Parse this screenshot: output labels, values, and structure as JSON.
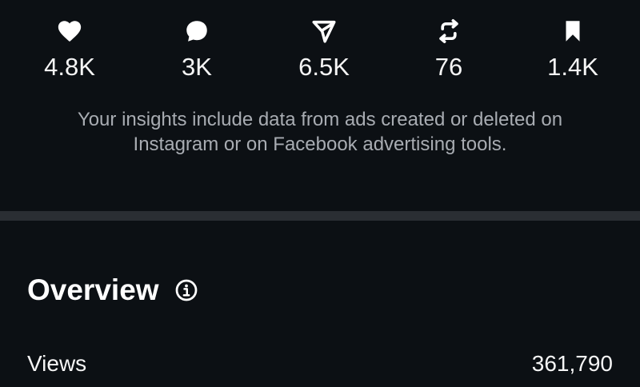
{
  "stats": [
    {
      "icon": "heart-icon",
      "value": "4.8K"
    },
    {
      "icon": "comment-icon",
      "value": "3K"
    },
    {
      "icon": "send-icon",
      "value": "6.5K"
    },
    {
      "icon": "repost-icon",
      "value": "76"
    },
    {
      "icon": "bookmark-icon",
      "value": "1.4K"
    }
  ],
  "note": "Your insights include data from ads created or deleted on Instagram or on Facebook advertising tools.",
  "overview": {
    "title": "Overview",
    "info_icon": "info-icon",
    "rows": [
      {
        "label": "Views",
        "value": "361,790"
      }
    ]
  },
  "colors": {
    "background": "#0c1014",
    "text": "#f5f5f5",
    "secondary_text": "#a8acb2",
    "divider": "#2a2e33"
  }
}
